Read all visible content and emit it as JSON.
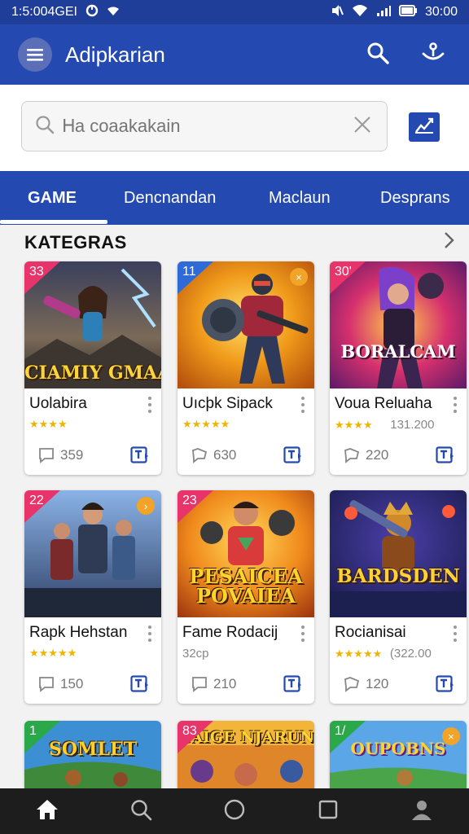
{
  "status_bar": {
    "left_text": "1:5:004GEI",
    "time": "30:00"
  },
  "app_bar": {
    "title": "Adipkarian",
    "icons": [
      "menu-icon",
      "search-icon",
      "joystick-icon"
    ]
  },
  "search": {
    "placeholder": "Ꮋa coaakakain",
    "icons": [
      "search-icon",
      "clear-icon",
      "filter-icon"
    ]
  },
  "tabs": [
    {
      "label": "GAME",
      "active": true
    },
    {
      "label": "Dencnandan",
      "active": false
    },
    {
      "label": "Maclaun",
      "active": false
    },
    {
      "label": "Desprans",
      "active": false
    }
  ],
  "section": {
    "title": "KATEGRAS"
  },
  "cards": [
    {
      "badge": "33",
      "badge_color": "#e8346a",
      "thumb_text": "CIAMIY GMAAN",
      "name": "Uolabira",
      "rating": "★★★★",
      "comments": "359"
    },
    {
      "badge": "11",
      "badge_color": "#2e6bd6",
      "corner": "×",
      "name": "Uıcþk Sipack",
      "rating": "★★★★★",
      "comments": "630"
    },
    {
      "badge": "30'",
      "badge_color": "#e8346a",
      "thumb_text": "BORALCAM",
      "name": "Voua Reluaha",
      "rating": "★★★★",
      "meta": "131.200",
      "comments": "220"
    },
    {
      "badge": "22",
      "badge_color": "#e8346a",
      "corner": "›",
      "name": "Rapk Hehstan",
      "rating": "★★★★★",
      "comments": "150"
    },
    {
      "badge": "23",
      "badge_color": "#e8346a",
      "thumb_text": "PESAICEA POVAIEA",
      "name": "Fame Rodacij",
      "meta": "32cp",
      "comments": "210"
    },
    {
      "badge": "",
      "badge_color": "#2e6bd6",
      "thumb_text": "BARDSDEN",
      "name": "Rocianisai",
      "rating": "★★★★★",
      "meta": "(322.00",
      "comments": "120"
    },
    {
      "badge": "1",
      "badge_color": "#2aa84a",
      "thumb_text": "SOMLET"
    },
    {
      "badge": "83",
      "badge_color": "#e8346a",
      "thumb_text": "BAIGE NJARUN"
    },
    {
      "badge": "1/",
      "badge_color": "#2aa84a",
      "corner": "×",
      "thumb_text": "OUPOBNS"
    }
  ],
  "bottom_nav": [
    "home-icon",
    "search-icon",
    "circle-icon",
    "square-icon",
    "profile-icon"
  ],
  "colors": {
    "primary": "#2449b0",
    "status_bar": "#1e3e9a",
    "star": "#f0b400",
    "nav_bg": "#1d1d1d"
  }
}
